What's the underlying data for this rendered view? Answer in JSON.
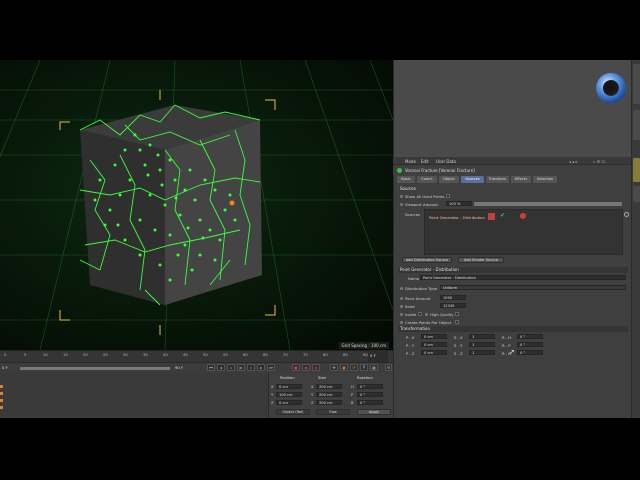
{
  "viewport": {
    "grid_spacing": "Grid Spacing : 100 cm"
  },
  "attribute_manager": {
    "menu": [
      "Mode",
      "Edit",
      "User Data"
    ],
    "object_title": "Voronoi Fracture [Voronoi Fracture]",
    "tabs": [
      "Basic",
      "Coord.",
      "Object",
      "Sources",
      "Transform",
      "Effects",
      "Selection"
    ],
    "active_tab": "Sources",
    "sources_section": {
      "title": "Sources",
      "show_all_used_points": "Show All Used Points",
      "viewport_amount_label": "Viewport Amount",
      "viewport_amount_value": "100 %",
      "sources_label": "Sources",
      "source_item": "Point Generator - Distribution",
      "add_distribution_button": "Add Distribution Source",
      "add_shader_button": "Add Shader Source"
    },
    "point_generator": {
      "title": "Point Generator - Distribution",
      "name_label": "Name",
      "name_value": "Point Generator - Distribution",
      "distribution_type_label": "Distribution Type",
      "distribution_type_value": "Uniform",
      "point_amount_label": "Point Amount",
      "point_amount_value": "1000",
      "seed_label": "Seed",
      "seed_value": "12345",
      "inside_label": "Inside",
      "high_quality_label": "High Quality",
      "create_points_label": "Create Points Per Object"
    },
    "transformation": {
      "title": "Transformation",
      "rows": [
        {
          "p": "P . X",
          "pv": "0 cm",
          "s": "S . X",
          "sv": "1",
          "r": "R . H",
          "rv": "0 °"
        },
        {
          "p": "P . Y",
          "pv": "0 cm",
          "s": "S . Y",
          "sv": "1",
          "r": "R . P",
          "rv": "0 °"
        },
        {
          "p": "P . Z",
          "pv": "0 cm",
          "s": "S . Z",
          "sv": "1",
          "r": "R . B",
          "rv": "0 °"
        }
      ]
    }
  },
  "timeline": {
    "ticks": [
      "0",
      "5",
      "10",
      "15",
      "20",
      "25",
      "30",
      "35",
      "40",
      "45",
      "50",
      "55",
      "60",
      "65",
      "70",
      "75",
      "80",
      "85",
      "90"
    ],
    "current_frame": "0 F",
    "start_frame": "0 F",
    "end_frame": "90 F"
  },
  "coordinates": {
    "headers": [
      "Position",
      "Size",
      "Rotation"
    ],
    "rows": [
      {
        "axis": "X",
        "pos": "0 cm",
        "size_axis": "X",
        "size": "200 cm",
        "rot_axis": "H",
        "rot": "0 °"
      },
      {
        "axis": "Y",
        "pos": "100 cm",
        "size_axis": "Y",
        "size": "200 cm",
        "rot_axis": "P",
        "rot": "0 °"
      },
      {
        "axis": "Z",
        "pos": "0 cm",
        "size_axis": "Z",
        "size": "200 cm",
        "rot_axis": "B",
        "rot": "0 °"
      }
    ],
    "mode_select": "Object (Rel)",
    "size_select": "Size",
    "apply_button": "Apply"
  },
  "colors": {
    "accent_green": "#39ff3a",
    "selection_yellow": "#e6c13a",
    "active_tab": "#5a6f9c"
  }
}
